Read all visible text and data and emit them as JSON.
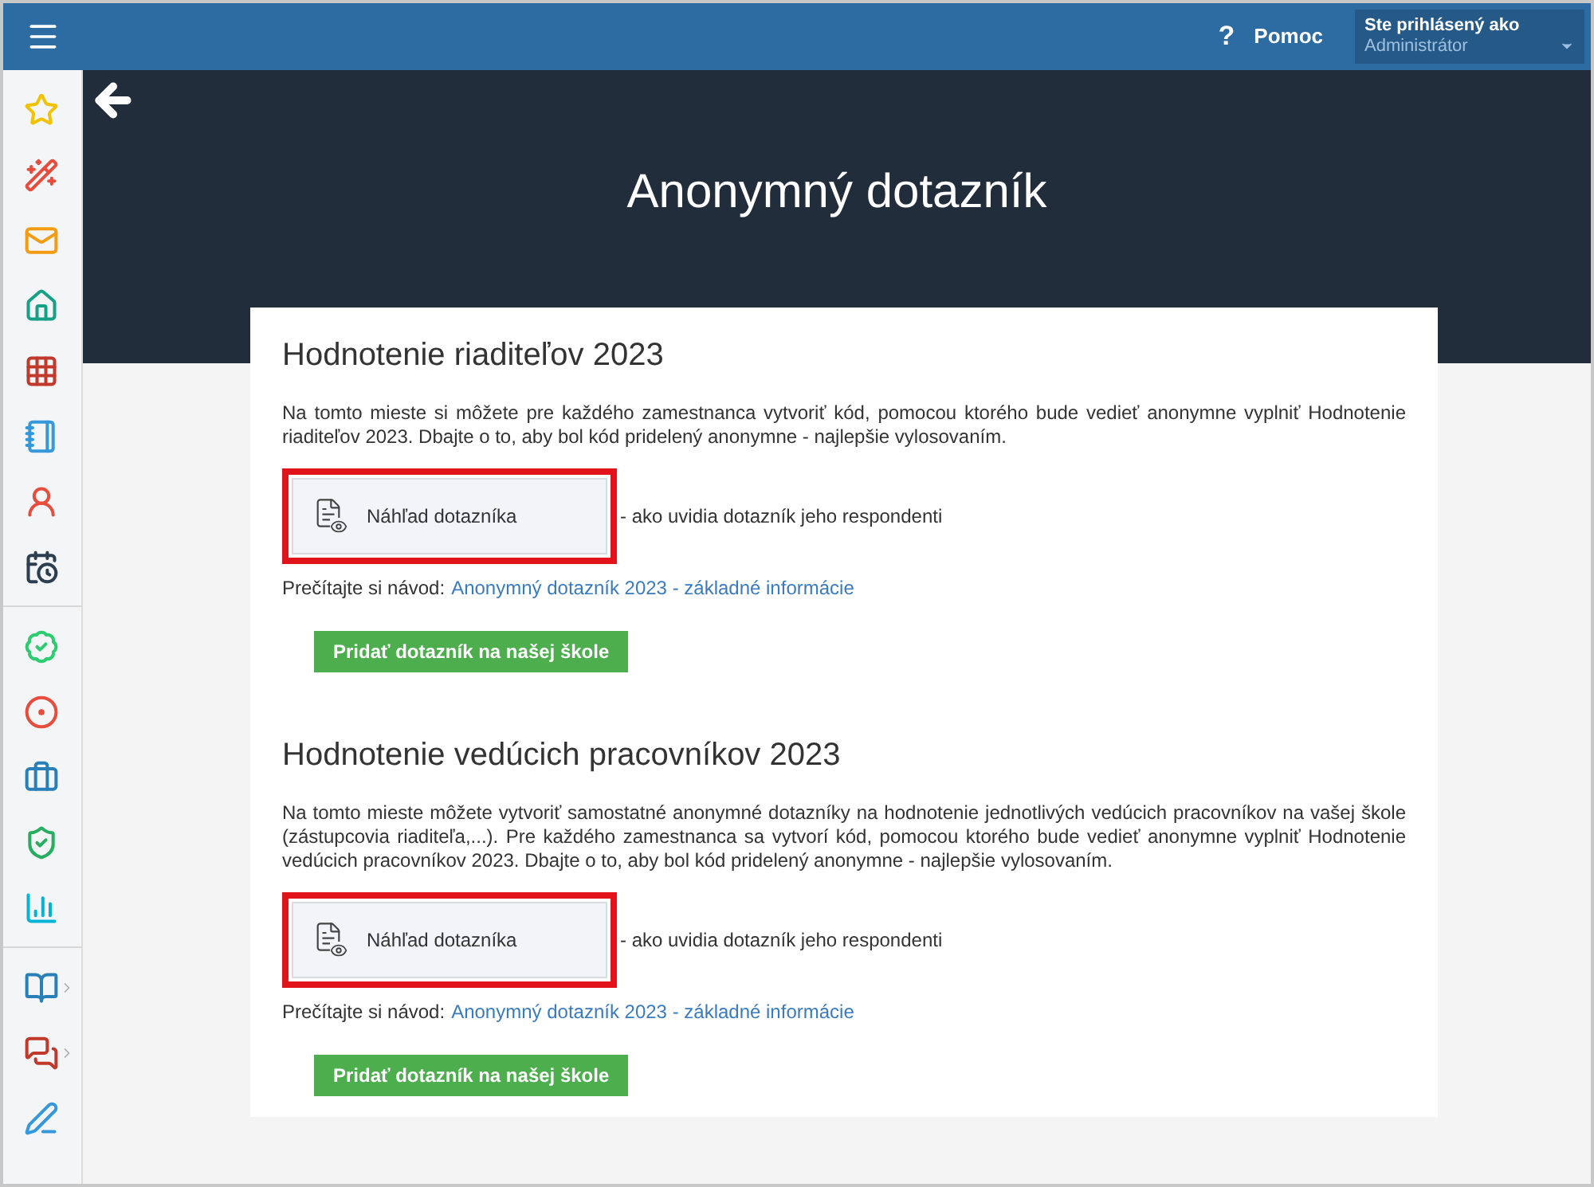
{
  "top_bar": {
    "help_icon": "?",
    "help": "Pomoc",
    "user": {
      "label": "Ste prihlásený ako",
      "name": "Administrátor"
    }
  },
  "sidebar": {
    "groups": [
      {
        "items": [
          {
            "submenu": false
          },
          {
            "submenu": false
          },
          {
            "submenu": false
          },
          {
            "submenu": false
          },
          {
            "submenu": false
          },
          {
            "submenu": false
          },
          {
            "submenu": false
          },
          {
            "submenu": false
          }
        ]
      },
      {
        "items": [
          {
            "submenu": false
          },
          {
            "submenu": false
          },
          {
            "submenu": false
          },
          {
            "submenu": false
          },
          {
            "submenu": false
          }
        ]
      },
      {
        "items": [
          {
            "submenu": true
          },
          {
            "submenu": true
          },
          {
            "submenu": false
          }
        ]
      }
    ]
  },
  "page_title": "Anonymný dotazník",
  "sections": [
    {
      "title": "Hodnotenie riaditeľov 2023",
      "description": "Na tomto mieste si môžete pre každého zamestnanca vytvoriť kód, pomocou ktorého bude vedieť anonymne vyplniť Hodnotenie riaditeľov 2023. Dbajte o to, aby bol kód pridelený anonymne - najlepšie vylosovaním.",
      "preview_button": "Náhľad dotazníka",
      "highlighted": true,
      "preview_note": "- ako uvidia dotazník jeho respondenti",
      "guide_label": "Prečítajte si návod:",
      "guide_link": "Anonymný dotazník 2023 - základné informácie",
      "add_button": "Pridať dotazník na našej škole"
    },
    {
      "title": "Hodnotenie vedúcich pracovníkov 2023",
      "description": "Na tomto mieste môžete vytvoriť samostatné anonymné dotazníky na hodnotenie jednotlivých vedúcich pracovníkov na vašej škole (zástupcovia riaditeľa,...). Pre každého zamestnanca sa vytvorí kód, pomocou ktorého bude vedieť anonymne vyplniť Hodnotenie vedúcich pracovníkov 2023. Dbajte o to, aby bol kód pridelený anonymne - najlepšie vylosovaním.",
      "preview_button": "Náhľad dotazníka",
      "highlighted": true,
      "preview_note": "- ako uvidia dotazník jeho respondenti",
      "guide_label": "Prečítajte si návod:",
      "guide_link": "Anonymný dotazník 2023 - základné informácie",
      "add_button": "Pridať dotazník na našej škole"
    }
  ]
}
